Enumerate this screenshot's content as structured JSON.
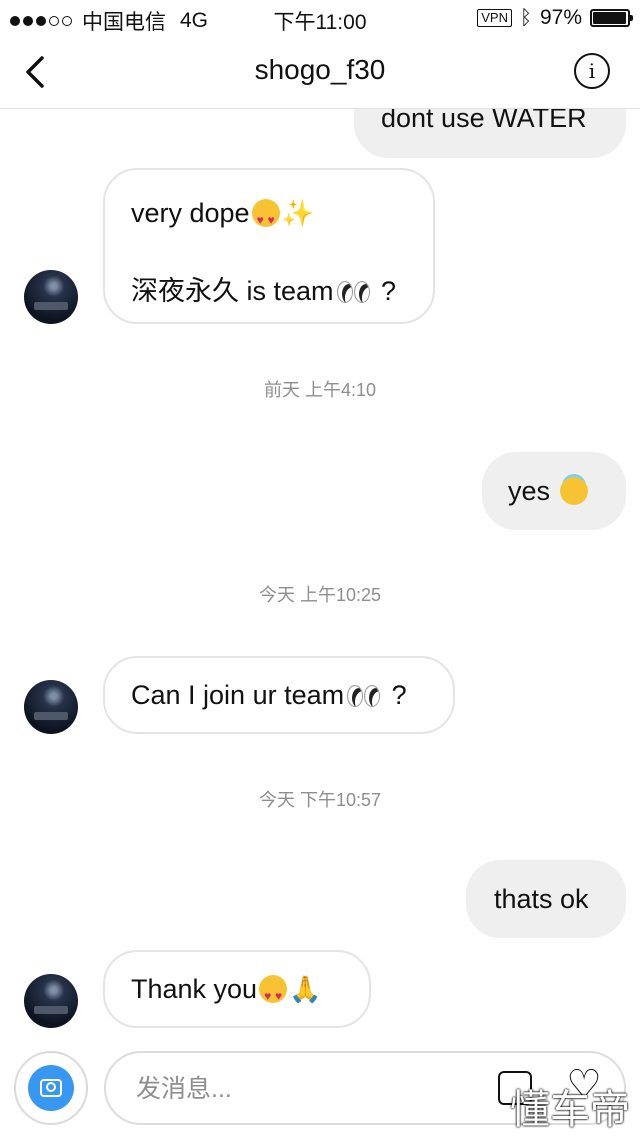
{
  "status_bar": {
    "carrier": "中国电信",
    "network": "4G",
    "time": "下午11:00",
    "vpn": "VPN",
    "battery_percent": "97%",
    "battery_level": 0.97
  },
  "header": {
    "title": "shogo_f30"
  },
  "messages": {
    "m0": {
      "text": "dont use WATER"
    },
    "m1": {
      "line1": "very dope",
      "line2": "深夜永久 is team",
      "line2_suffix": " ?"
    },
    "t1": "前天 上午4:10",
    "m2": {
      "text": "yes "
    },
    "t2": "今天 上午10:25",
    "m3": {
      "text": "Can I join ur team",
      "suffix": " ?"
    },
    "t3": "今天 下午10:57",
    "m4": {
      "text": "thats ok"
    },
    "m5": {
      "text": "Thank you"
    }
  },
  "composer": {
    "placeholder": "发消息..."
  },
  "watermark": "懂车帝",
  "colors": {
    "accent": "#3897f0",
    "outgoing_bubble": "#efefef",
    "timestamp": "#8e8e8e"
  }
}
